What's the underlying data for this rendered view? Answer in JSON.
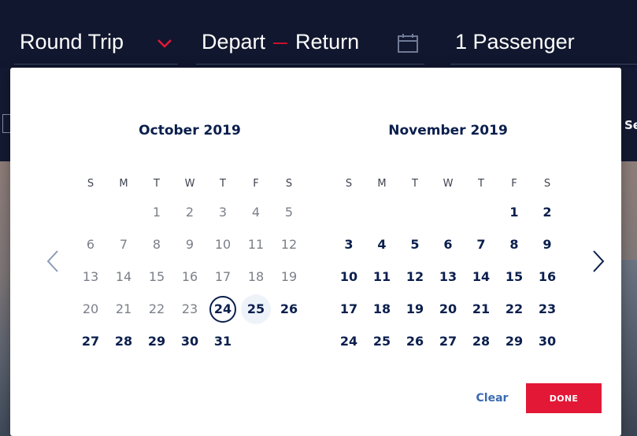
{
  "booking_bar": {
    "trip_type": "Round Trip",
    "depart_label": "Depart",
    "return_label": "Return",
    "passengers": "1 Passenger"
  },
  "edge_text": "Se",
  "calendar": {
    "weekdays": [
      "S",
      "M",
      "T",
      "W",
      "T",
      "F",
      "S"
    ],
    "months": [
      {
        "title": "October 2019",
        "first_weekday": 2,
        "days": 31,
        "past_until": 23,
        "today": 24,
        "hover": 25
      },
      {
        "title": "November 2019",
        "first_weekday": 5,
        "days": 30,
        "past_until": 0,
        "today": null,
        "hover": null
      }
    ],
    "icons": {
      "prev": "chevron-left-icon",
      "next": "chevron-right-icon",
      "calendar": "calendar-icon",
      "dropdown": "chevron-down-icon"
    },
    "clear_label": "Clear",
    "done_label": "DONE"
  },
  "colors": {
    "navy": "#0b1f4d",
    "accent_red": "#e31837",
    "link_blue": "#3a6ab0",
    "header_bg": "#11172e"
  }
}
